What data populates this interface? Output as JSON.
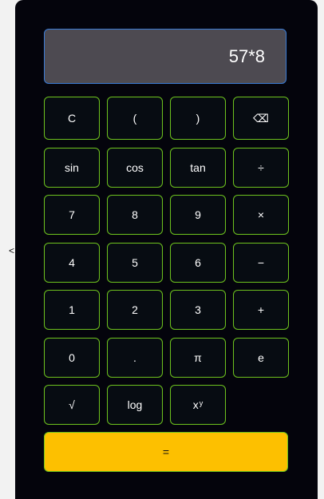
{
  "page": {
    "stray_glyph": "<"
  },
  "display": {
    "expression": "57*8"
  },
  "keys": {
    "clear": "C",
    "paren_open": "(",
    "paren_close": ")",
    "backspace": "⌫",
    "sin": "sin",
    "cos": "cos",
    "tan": "tan",
    "divide": "÷",
    "seven": "7",
    "eight": "8",
    "nine": "9",
    "multiply": "×",
    "four": "4",
    "five": "5",
    "six": "6",
    "minus": "−",
    "one": "1",
    "two": "2",
    "three": "3",
    "plus": "+",
    "zero": "0",
    "decimal": ".",
    "pi": "π",
    "e": "e",
    "sqrt": "√",
    "log": "log",
    "power_base": "x",
    "power_exp": "y",
    "equals": "="
  },
  "colors": {
    "calculator_body": "#04040c",
    "display_bg": "#4d4a51",
    "display_border": "#3a7bd5",
    "key_bg": "#070c12",
    "key_border": "#6ec31e",
    "equals_bg": "#fdc000"
  }
}
